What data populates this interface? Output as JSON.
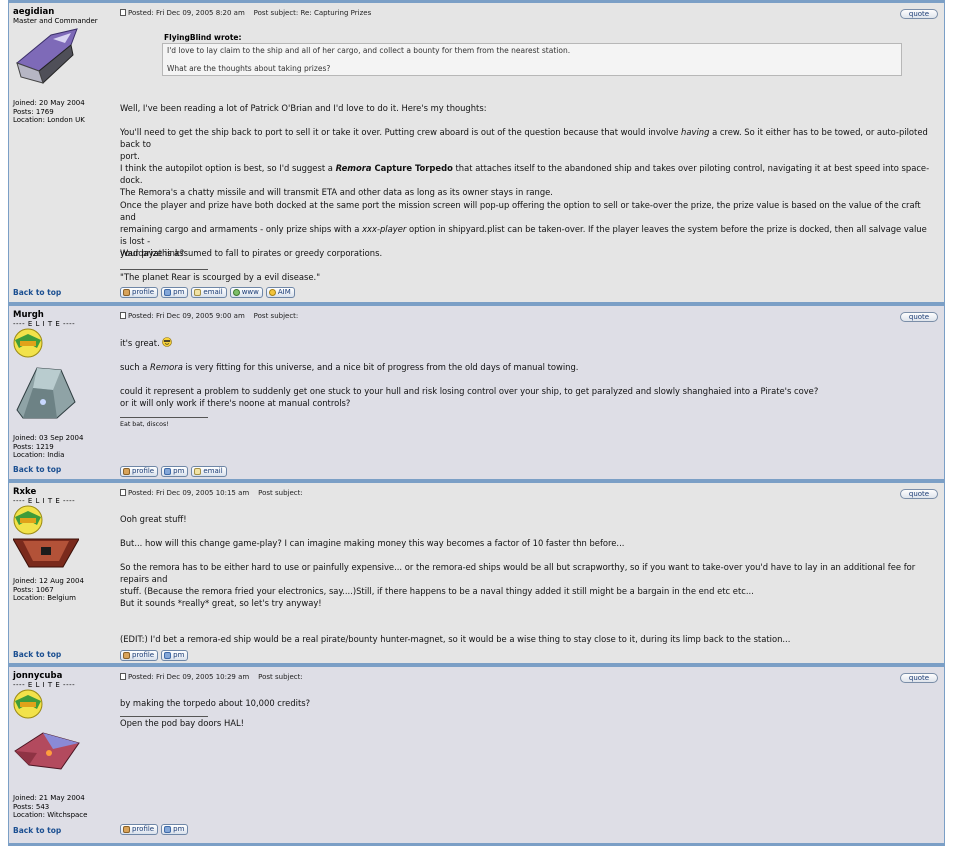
{
  "posts": [
    {
      "username": "aegidian",
      "rank": "Master and Commander",
      "joined": "Joined: 20 May 2004",
      "posts": "Posts: 1769",
      "location": "Location: London UK",
      "back_to_top": "Back to top",
      "posted": "Posted: Fri Dec 09, 2005 8:20 am",
      "subject": "Post subject: Re: Capturing Prizes",
      "quote_label": "quote",
      "quote_author": "FlyingBlind wrote:",
      "quote_line1": "I'd love to lay claim to the ship and all of her cargo, and collect a bounty for them from the nearest station.",
      "quote_line2": "What are the thoughts about taking prizes?",
      "p1": "Well, I've been reading a lot of Patrick O'Brian and I'd love to do it. Here's my thoughts:",
      "p2a": "You'll need to get the ship back to port to sell it or take it over. Putting crew aboard is out of the question because that would involve ",
      "p2em": "having",
      "p2b": " a crew. So it either has to be towed, or auto-piloted back to",
      "p2c": "port.",
      "p3a": "I think the autopilot option is best, so I'd suggest a ",
      "p3strong": "Remora",
      "p3strong2": " Capture Torpedo",
      "p3b": " that attaches itself to the abandoned ship and takes over piloting control, navigating it at best speed into space-dock.",
      "p3c": "The Remora's a chatty missile and will transmit ETA and other data as long as its owner stays in range.",
      "p4a": "Once the player and prize have both docked at the same port the mission screen will pop-up offering the option to sell or take-over the prize, the prize value is based on the value of the craft and",
      "p4b": "remaining cargo and armaments - only prize ships with a ",
      "p4em": "xxx-player",
      "p4c": " option in shipyard.plist can be taken-over. If the player leaves the system before the prize is docked, then all salvage value is lost -",
      "p4d": "your prize is assumed to fall to pirates or greedy corporations.",
      "p5": "Waddayathink?",
      "signature": "\"The planet Rear is scourged by a evil disease.\"",
      "buttons": [
        "profile",
        "pm",
        "email",
        "www",
        "AIM"
      ]
    },
    {
      "username": "Murgh",
      "rank": "---- E L I T E ----",
      "joined": "Joined: 03 Sep 2004",
      "posts": "Posts: 1219",
      "location": "Location: India",
      "back_to_top": "Back to top",
      "posted": "Posted: Fri Dec 09, 2005 9:00 am",
      "subject": "Post subject:",
      "quote_label": "quote",
      "p1": "it's great.",
      "p2a": "such a ",
      "p2em": "Remora",
      "p2b": " is very fitting for this universe, and a nice bit of progress from the old days of manual towing.",
      "p3": "could it represent a problem to suddenly get one stuck to your hull and risk losing control over your ship, to get paralyzed and slowly shanghaied into a Pirate's cove?",
      "p4": "or it will only work if there's noone at manual controls?",
      "signature": "Eat bat, discos!",
      "buttons": [
        "profile",
        "pm",
        "email"
      ]
    },
    {
      "username": "Rxke",
      "rank": "---- E L I T E ----",
      "joined": "Joined: 12 Aug 2004",
      "posts": "Posts: 1067",
      "location": "Location: Belgium",
      "back_to_top": "Back to top",
      "posted": "Posted: Fri Dec 09, 2005 10:15 am",
      "subject": "Post subject:",
      "quote_label": "quote",
      "p1": "Ooh great stuff!",
      "p2": "But... how will this change game-play? I can imagine making money this way becomes a factor of 10 faster thn before...",
      "p3a": "So the remora has to be either hard to use or painfully expensive... or the remora-ed ships would be all but scrapworthy, so if you want to take-over you'd have to lay in an additional fee for repairs and",
      "p3b": "stuff. (Because the remora fried your electronics, say....)Still, if there happens to be a naval thingy added it still might be a bargain in the end etc etc...",
      "p4": "But it sounds *really* great, so let's try anyway!",
      "p5": "(EDIT:) I'd bet a remora-ed ship would be a real pirate/bounty hunter-magnet, so it would be a wise thing to stay close to it, during its limp back to the station...",
      "buttons": [
        "profile",
        "pm"
      ]
    },
    {
      "username": "jonnycuba",
      "rank": "---- E L I T E ----",
      "joined": "Joined: 21 May 2004",
      "posts": "Posts: 543",
      "location": "Location: Witchspace",
      "back_to_top": "Back to top",
      "posted": "Posted: Fri Dec 09, 2005 10:29 am",
      "subject": "Post subject:",
      "quote_label": "quote",
      "p1": "by making the torpedo about 10,000 credits?",
      "signature": "Open the pod bay doors HAL!",
      "buttons": [
        "profile",
        "pm"
      ]
    }
  ],
  "icons": {
    "post": "document-icon",
    "smiley": "cool-smiley-icon"
  }
}
